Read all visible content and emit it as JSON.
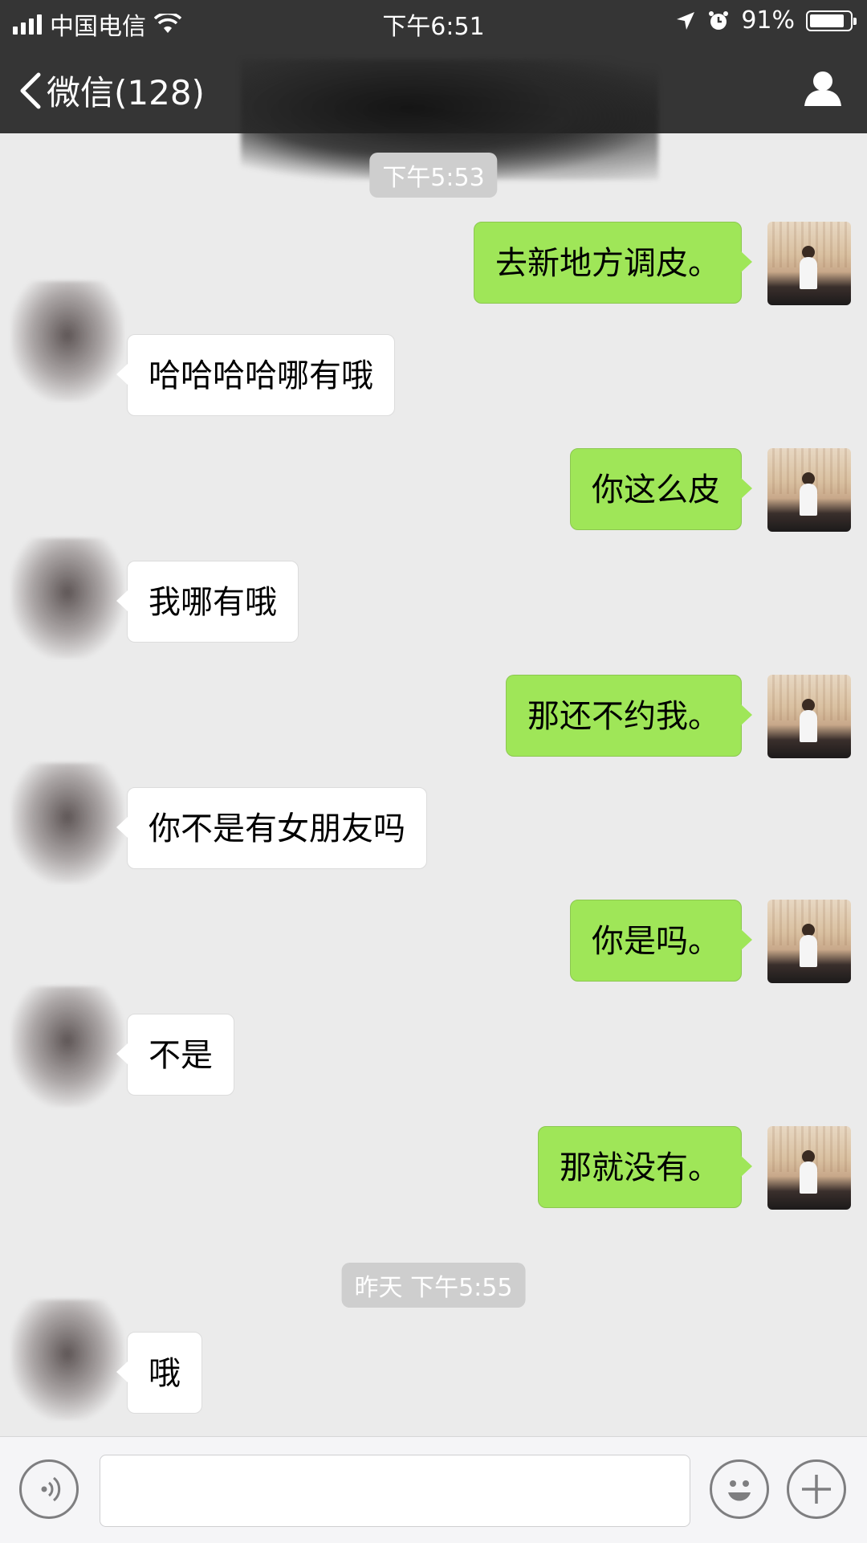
{
  "status_bar": {
    "carrier": "中国电信",
    "time": "下午6:51",
    "battery_percent": "91%",
    "battery_level": 0.91
  },
  "nav": {
    "back_label": "微信(128)"
  },
  "messages": [
    {
      "type": "timestamp",
      "text": "下午5:53"
    },
    {
      "sender": "me",
      "text": "去新地方调皮。"
    },
    {
      "sender": "other",
      "text": "哈哈哈哈哪有哦"
    },
    {
      "sender": "me",
      "text": "你这么皮"
    },
    {
      "sender": "other",
      "text": "我哪有哦"
    },
    {
      "sender": "me",
      "text": "那还不约我。"
    },
    {
      "sender": "other",
      "text": "你不是有女朋友吗"
    },
    {
      "sender": "me",
      "text": "你是吗。"
    },
    {
      "sender": "other",
      "text": "不是"
    },
    {
      "sender": "me",
      "text": "那就没有。"
    },
    {
      "type": "timestamp",
      "text": "昨天 下午5:55"
    },
    {
      "sender": "other",
      "text": "哦"
    }
  ],
  "input_bar": {
    "text_value": "",
    "icons": [
      "voice-icon",
      "emoji-icon",
      "plus-icon"
    ]
  }
}
